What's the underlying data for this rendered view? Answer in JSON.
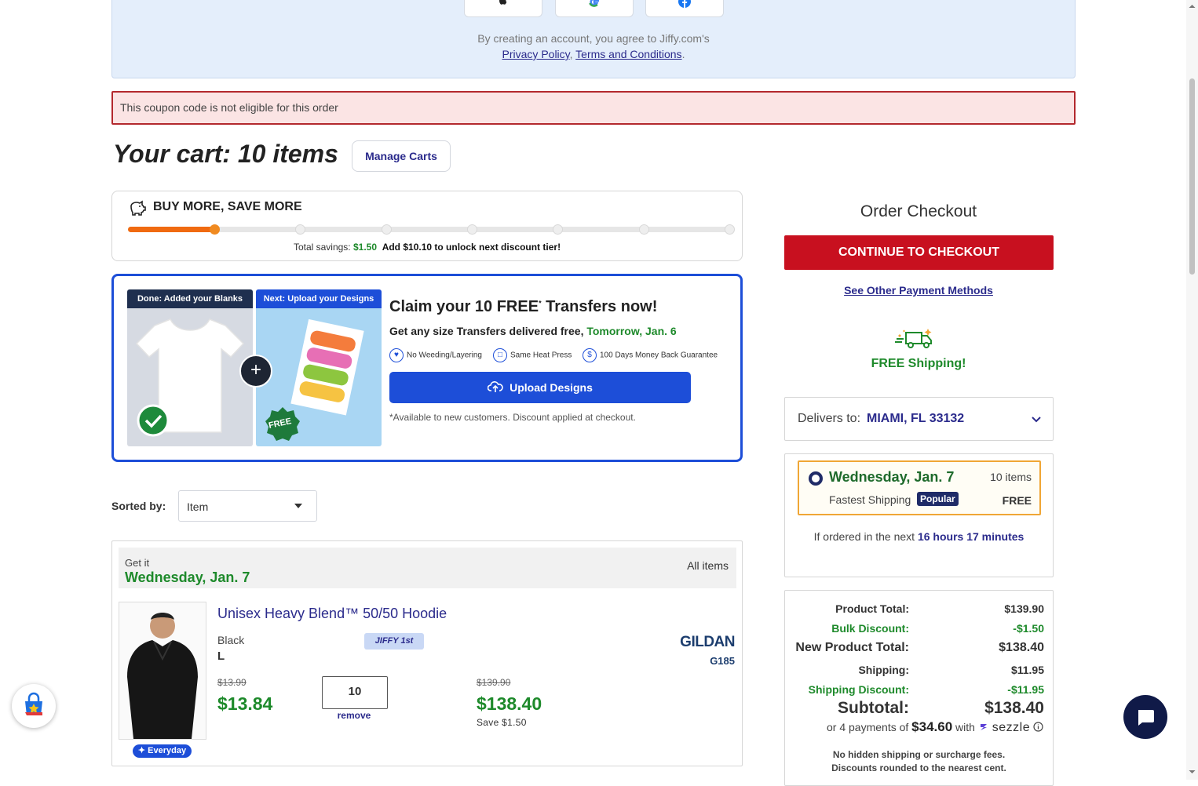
{
  "signup": {
    "social": [
      "apple-icon",
      "google-icon",
      "facebook-icon"
    ],
    "terms_line1": "By creating an account, you agree to Jiffy.com's",
    "privacy_link": "Privacy Policy",
    "terms_link": "Terms and Conditions",
    "separator": ",",
    "period": "."
  },
  "alert": {
    "coupon_error": "This coupon code is not eligible for this order"
  },
  "cart": {
    "title": "Your cart: 10 items",
    "manage_label": "Manage Carts"
  },
  "buy_more": {
    "title": "BUY MORE, SAVE MORE",
    "progress_fraction": 0.145,
    "tiers_total": 8,
    "tiers_reached": 2,
    "savings_label": "Total savings:",
    "savings_value": "$1.50",
    "unlock_text": "Add $10.10 to unlock next discount tier!"
  },
  "claim": {
    "step1_label": "Done: Added your Blanks",
    "step2_label": "Next: Upload your Designs",
    "free_stamp": "FREE",
    "title_pre": "Claim your 10 FREE",
    "title_sup": "*",
    "title_post": " Transfers now!",
    "subtitle_pre": "Get any size Transfers delivered free, ",
    "subtitle_date": "Tomorrow, Jan. 6",
    "perks": [
      "No Weeding/Layering",
      "Same Heat Press",
      "100 Days Money Back Guarantee"
    ],
    "upload_label": "Upload Designs",
    "note": "*Available to new customers. Discount applied at checkout."
  },
  "sort": {
    "label": "Sorted by:",
    "value": "Item"
  },
  "group": {
    "get_it": "Get it",
    "date": "Wednesday, Jan. 7",
    "all_items": "All items"
  },
  "item": {
    "name": "Unisex Heavy Blend™ 50/50 Hoodie",
    "color": "Black",
    "size": "L",
    "badge": "JIFFY 1st",
    "everyday_badge": "Everyday",
    "brand": "GILDAN",
    "sku": "G185",
    "old_price": "$13.99",
    "price": "$13.84",
    "qty": "10",
    "remove_label": "remove",
    "old_total": "$139.90",
    "line_total": "$138.40",
    "save_text": "Save $1.50"
  },
  "checkout": {
    "title": "Order Checkout",
    "continue_label": "CONTINUE TO CHECKOUT",
    "other_payment": "See Other Payment Methods",
    "free_shipping": "FREE Shipping!",
    "delivers_label": "Delivers to:",
    "delivers_location": "MIAMI, FL 33132"
  },
  "shipping_option": {
    "date": "Wednesday, Jan. 7",
    "items": "10 items",
    "speed": "Fastest Shipping",
    "badge": "Popular",
    "cost": "FREE",
    "cutoff_pre": "If ordered in the next ",
    "cutoff_time": "16 hours 17 minutes"
  },
  "summary": {
    "rows": [
      {
        "label": "Product Total:",
        "value": "$139.90"
      },
      {
        "label": "Bulk Discount:",
        "value": "-$1.50"
      },
      {
        "label": "New Product Total:",
        "value": "$138.40"
      },
      {
        "label": "Shipping:",
        "value": "$11.95"
      },
      {
        "label": "Shipping Discount:",
        "value": "-$11.95"
      },
      {
        "label": "Subtotal:",
        "value": "$138.40"
      }
    ],
    "sezzle_pre": "or 4 payments of ",
    "sezzle_amount": "$34.60",
    "sezzle_with": " with ",
    "sezzle_brand": "sezzle",
    "no_fees_1": "No hidden shipping or surcharge fees.",
    "no_fees_2": "Discounts rounded to the nearest cent."
  },
  "colors": {
    "brand_blue": "#1d4ed8",
    "navy": "#2b2b8c",
    "checkout_red": "#c8101f",
    "green": "#1e8a2b",
    "progress_orange": "#f06a10"
  }
}
